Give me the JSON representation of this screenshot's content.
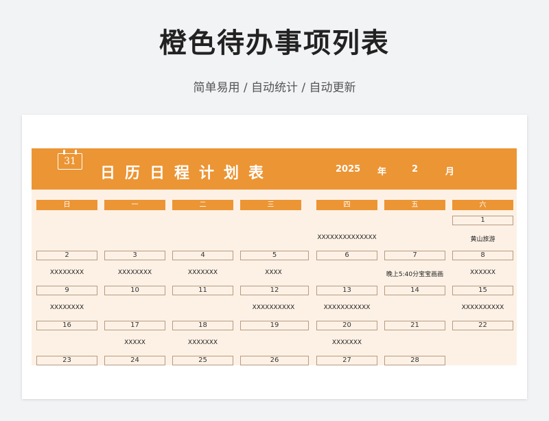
{
  "header": {
    "title": "橙色待办事项列表",
    "subtitle": "简单易用 / 自动统计 / 自动更新"
  },
  "calendar": {
    "icon_number": "31",
    "title": "日历日程计划表",
    "year": "2025",
    "year_char": "年",
    "month": "2",
    "month_char": "月",
    "weekdays": [
      "日",
      "一",
      "二",
      "三",
      "四",
      "五",
      "六"
    ],
    "days": {
      "d1": "1",
      "d2": "2",
      "d3": "3",
      "d4": "4",
      "d5": "5",
      "d6": "6",
      "d7": "7",
      "d8": "8",
      "d9": "9",
      "d10": "10",
      "d11": "11",
      "d12": "12",
      "d13": "13",
      "d14": "14",
      "d15": "15",
      "d16": "16",
      "d17": "17",
      "d18": "18",
      "d19": "19",
      "d20": "20",
      "d21": "21",
      "d22": "22",
      "d23": "23",
      "d24": "24",
      "d25": "25",
      "d26": "26",
      "d27": "27",
      "d28": "28"
    },
    "events": {
      "thu_w0": "XXXXXXXXXXXXXX",
      "sat_w0": "黄山旅游",
      "sun_w1": "XXXXXXXX",
      "mon_w1": "XXXXXXXX",
      "tue_w1": "XXXXXXX",
      "wed_w1": "XXXX",
      "fri_w1": "晚上5:40分宝宝画画",
      "sat_w1": "XXXXXX",
      "sun_w2": "XXXXXXXX",
      "wed_w2": "XXXXXXXXXX",
      "thu_w2": "XXXXXXXXXXX",
      "sat_w2": "XXXXXXXXXX",
      "mon_w3": "XXXXX",
      "tue_w3": "XXXXXXX",
      "thu_w3": "XXXXXXX"
    }
  },
  "colors": {
    "accent": "#ec9534",
    "sheet_bg": "#fdf1e5",
    "page_bg": "#f2f3f5"
  }
}
